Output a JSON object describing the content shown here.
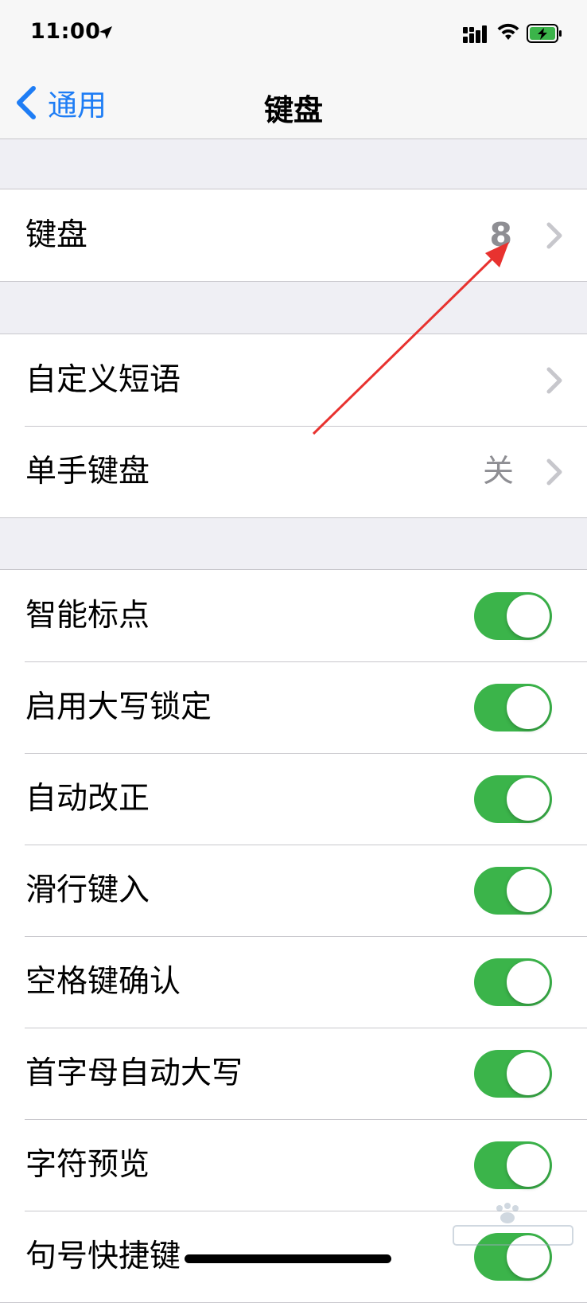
{
  "status_bar": {
    "time": "11:00"
  },
  "nav": {
    "back_label": "通用",
    "title": "键盘"
  },
  "group1": [
    {
      "label": "键盘",
      "value": "8"
    }
  ],
  "group2": [
    {
      "label": "自定义短语",
      "value": ""
    },
    {
      "label": "单手键盘",
      "value": "关"
    }
  ],
  "toggles": [
    {
      "label": "智能标点",
      "on": true
    },
    {
      "label": "启用大写锁定",
      "on": true
    },
    {
      "label": "自动改正",
      "on": true
    },
    {
      "label": "滑行键入",
      "on": true
    },
    {
      "label": "空格键确认",
      "on": true
    },
    {
      "label": "首字母自动大写",
      "on": true
    },
    {
      "label": "字符预览",
      "on": true
    },
    {
      "label": "句号快捷键",
      "on": true
    }
  ],
  "colors": {
    "accent": "#1e7df5",
    "toggle_on": "#3bb44a",
    "annotation": "#e8322f"
  },
  "icons": [
    "location-arrow-icon",
    "cellular-signal-icon",
    "wifi-icon",
    "battery-charging-icon",
    "back-chevron-icon",
    "disclosure-chevron-icon"
  ]
}
